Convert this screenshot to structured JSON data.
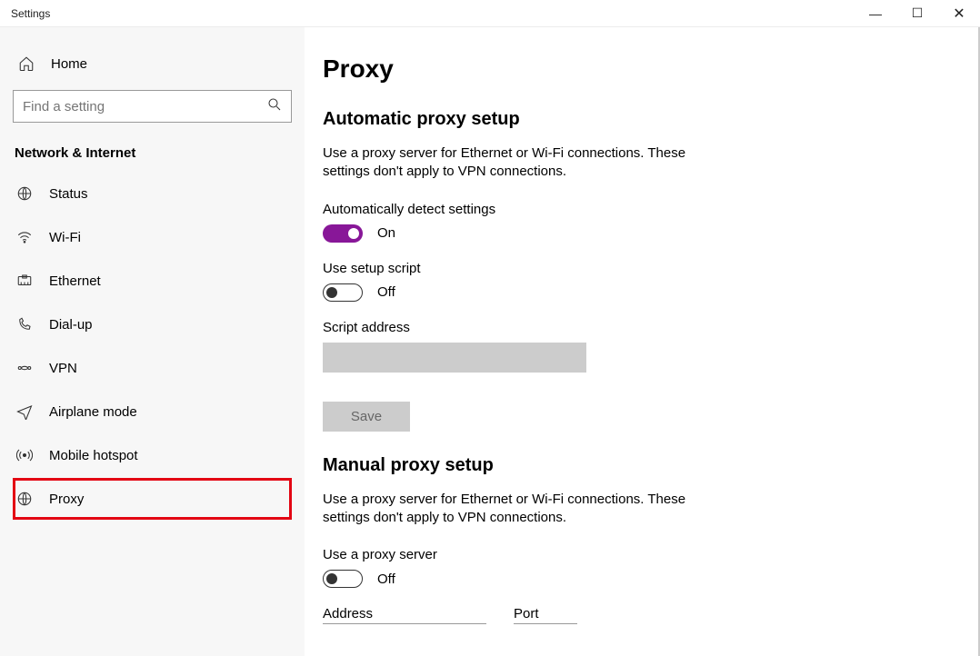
{
  "window": {
    "title": "Settings",
    "minimize": "—",
    "maximize": "☐",
    "close": "✕"
  },
  "sidebar": {
    "home_label": "Home",
    "search_placeholder": "Find a setting",
    "section_label": "Network & Internet",
    "items": [
      {
        "label": "Status",
        "icon": "status-icon"
      },
      {
        "label": "Wi-Fi",
        "icon": "wifi-icon"
      },
      {
        "label": "Ethernet",
        "icon": "ethernet-icon"
      },
      {
        "label": "Dial-up",
        "icon": "dialup-icon"
      },
      {
        "label": "VPN",
        "icon": "vpn-icon"
      },
      {
        "label": "Airplane mode",
        "icon": "airplane-icon"
      },
      {
        "label": "Mobile hotspot",
        "icon": "hotspot-icon"
      },
      {
        "label": "Proxy",
        "icon": "proxy-icon"
      }
    ]
  },
  "main": {
    "title": "Proxy",
    "auto": {
      "heading": "Automatic proxy setup",
      "desc": "Use a proxy server for Ethernet or Wi-Fi connections. These settings don't apply to VPN connections.",
      "detect_label": "Automatically detect settings",
      "detect_state": "On",
      "script_label": "Use setup script",
      "script_state": "Off",
      "script_addr_label": "Script address",
      "save_label": "Save"
    },
    "manual": {
      "heading": "Manual proxy setup",
      "desc": "Use a proxy server for Ethernet or Wi-Fi connections. These settings don't apply to VPN connections.",
      "use_label": "Use a proxy server",
      "use_state": "Off",
      "address_label": "Address",
      "port_label": "Port"
    }
  }
}
